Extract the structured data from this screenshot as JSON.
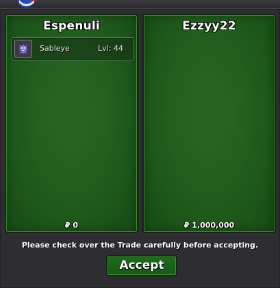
{
  "trade_window": {
    "notice": "Please check over the Trade carefully before accepting.",
    "accept_label": "Accept"
  },
  "left_panel": {
    "player_name": "Espenuli",
    "money": "₽ 0",
    "items": [
      {
        "name": "Sableye",
        "level": "Lvl: 44",
        "icon": "sableye-icon"
      }
    ]
  },
  "right_panel": {
    "player_name": "Ezzyy22",
    "money": "₽ 1,000,000",
    "items": []
  },
  "colors": {
    "panel_green": "#246120",
    "panel_border": "#10260f",
    "frame_bg": "#2f2f33",
    "button_green": "#1f6a1d"
  }
}
